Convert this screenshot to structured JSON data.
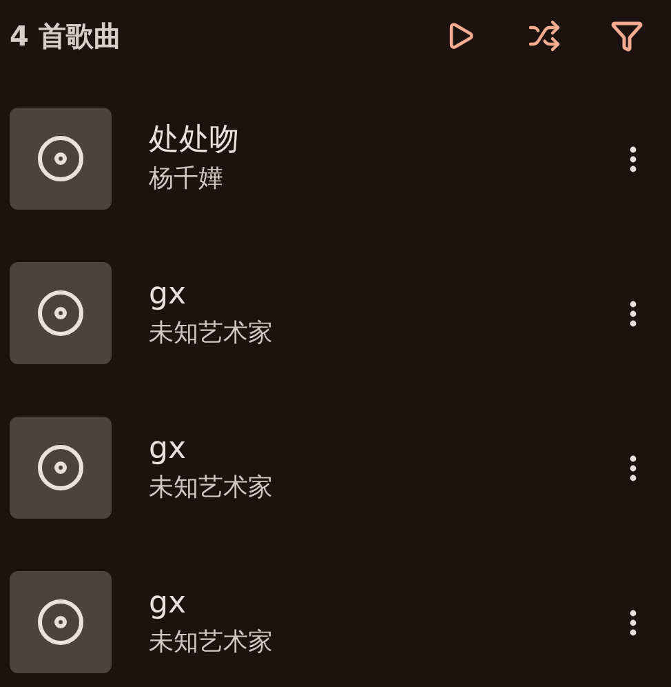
{
  "header": {
    "title": "4 首歌曲"
  },
  "songs": [
    {
      "title": "处处吻",
      "artist": "杨千嬅"
    },
    {
      "title": "gx",
      "artist": "未知艺术家"
    },
    {
      "title": "gx",
      "artist": "未知艺术家"
    },
    {
      "title": "gx",
      "artist": "未知艺术家"
    }
  ]
}
